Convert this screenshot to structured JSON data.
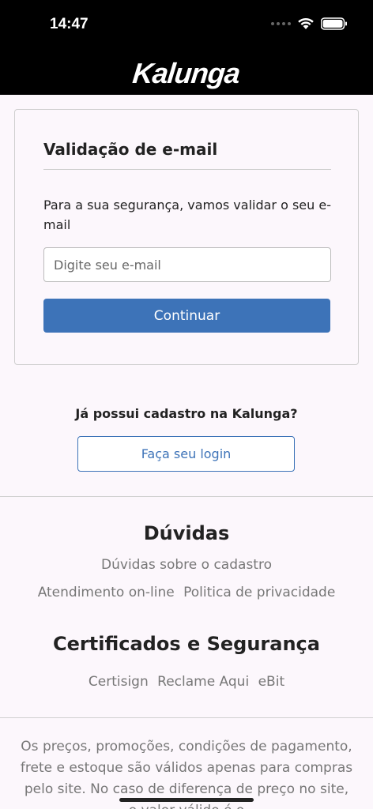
{
  "status_bar": {
    "time": "14:47"
  },
  "header": {
    "logo": "Kalunga"
  },
  "validation_card": {
    "title": "Validação de e-mail",
    "description": "Para a sua segurança, vamos validar o seu e-mail",
    "email_placeholder": "Digite seu e-mail",
    "email_value": "",
    "continue_label": "Continuar"
  },
  "login": {
    "question": "Já possui cadastro na Kalunga?",
    "button_label": "Faça seu login"
  },
  "footer": {
    "doubts_heading": "Dúvidas",
    "doubts_links": [
      "Dúvidas sobre o cadastro",
      "Atendimento on-line",
      "Politica de privacidade"
    ],
    "security_heading": "Certificados e Segurança",
    "security_links": [
      "Certisign",
      "Reclame Aqui",
      "eBit"
    ],
    "disclaimer": "Os preços, promoções, condições de pagamento, frete e estoque são válidos apenas para compras pelo site. No caso de diferença de preço no site, o valor válido é o"
  },
  "colors": {
    "accent": "#3d73b8",
    "background": "#fcf7fc",
    "header": "#000000"
  }
}
